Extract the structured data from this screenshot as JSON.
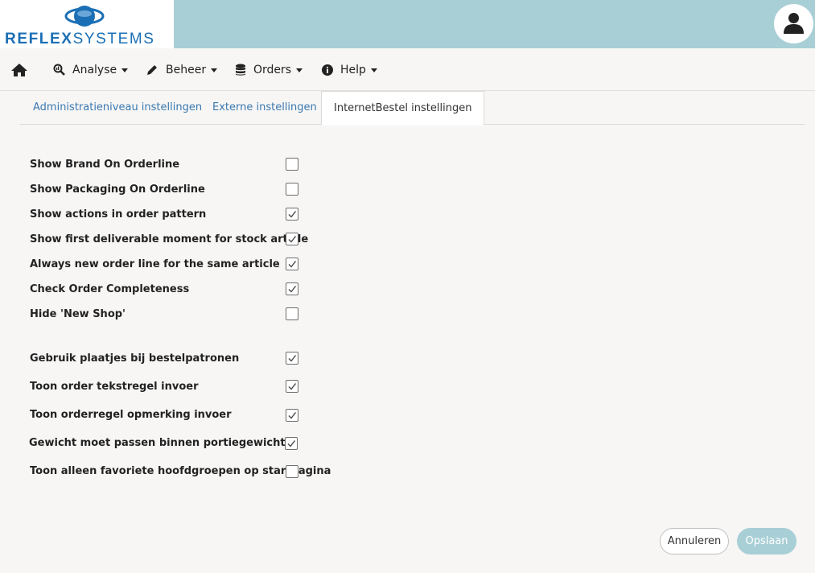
{
  "brand": {
    "name_bold": "REFLEX",
    "name_light": "SYSTEMS",
    "color": "#1b6fb5"
  },
  "colors": {
    "header": "#a9cfd6",
    "link": "#3a78b0",
    "primary_button": "#a9cfd6"
  },
  "nav": {
    "home_icon": "home-icon",
    "items": [
      {
        "label": "Analyse",
        "icon": "search-chart-icon"
      },
      {
        "label": "Beheer",
        "icon": "pencil-icon"
      },
      {
        "label": "Orders",
        "icon": "database-icon"
      },
      {
        "label": "Help",
        "icon": "info-icon"
      }
    ]
  },
  "tabs": [
    {
      "label": "Administratieniveau instellingen",
      "active": false
    },
    {
      "label": "Externe instellingen",
      "active": false
    },
    {
      "label": "InternetBestel instellingen",
      "active": true
    }
  ],
  "settings": [
    {
      "label": "Show Brand On Orderline",
      "checked": false
    },
    {
      "label": "Show Packaging On Orderline",
      "checked": false
    },
    {
      "label": "Show actions in order pattern",
      "checked": true
    },
    {
      "label": "Show first deliverable moment for stock article",
      "checked": true
    },
    {
      "label": "Always new order line for the same article",
      "checked": true
    },
    {
      "label": "Check Order Completeness",
      "checked": true
    },
    {
      "label": "Hide 'New Shop'",
      "checked": false
    },
    {
      "label": "Gebruik plaatjes bij bestelpatronen",
      "checked": true
    },
    {
      "label": "Toon order tekstregel invoer",
      "checked": true
    },
    {
      "label": "Toon orderregel opmerking invoer",
      "checked": true
    },
    {
      "label": "Gewicht moet passen binnen portiegewicht",
      "checked": true
    },
    {
      "label": "Toon alleen favoriete hoofdgroepen op startpagina",
      "checked": false
    }
  ],
  "actions": {
    "cancel_label": "Annuleren",
    "save_label": "Opslaan"
  }
}
